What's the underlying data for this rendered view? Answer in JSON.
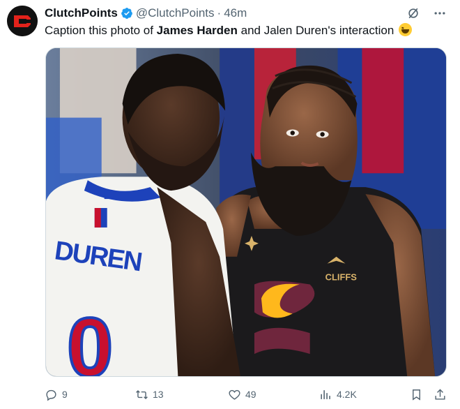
{
  "post": {
    "display_name": "ClutchPoints",
    "handle": "@ClutchPoints",
    "separator": "·",
    "time": "46m",
    "text_before": "Caption this photo of ",
    "text_bold": "James Harden",
    "text_after": " and Jalen Duren's interaction ",
    "emoji": "grinning-squinting-face"
  },
  "media": {
    "jersey_left": "DUREN",
    "jersey_left_number": "0",
    "jersey_right_logo": "CLIFFS",
    "colors": {
      "pistons_red": "#c8102e",
      "pistons_blue": "#1d42ba",
      "cavs_wine": "#6f263d",
      "cavs_gold": "#ffb81c"
    }
  },
  "actions": {
    "replies": "9",
    "reposts": "13",
    "likes": "49",
    "views": "4.2K"
  },
  "icons": {
    "verified": "verified-badge-icon",
    "grok": "grok-icon",
    "more": "more-icon",
    "reply": "reply-icon",
    "repost": "repost-icon",
    "like": "like-icon",
    "views": "views-icon",
    "bookmark": "bookmark-icon",
    "share": "share-icon"
  },
  "colors": {
    "text": "#0f1419",
    "muted": "#536471",
    "verified": "#1d9bf0",
    "avatar_bg": "#111111",
    "avatar_red": "#e3221b"
  }
}
